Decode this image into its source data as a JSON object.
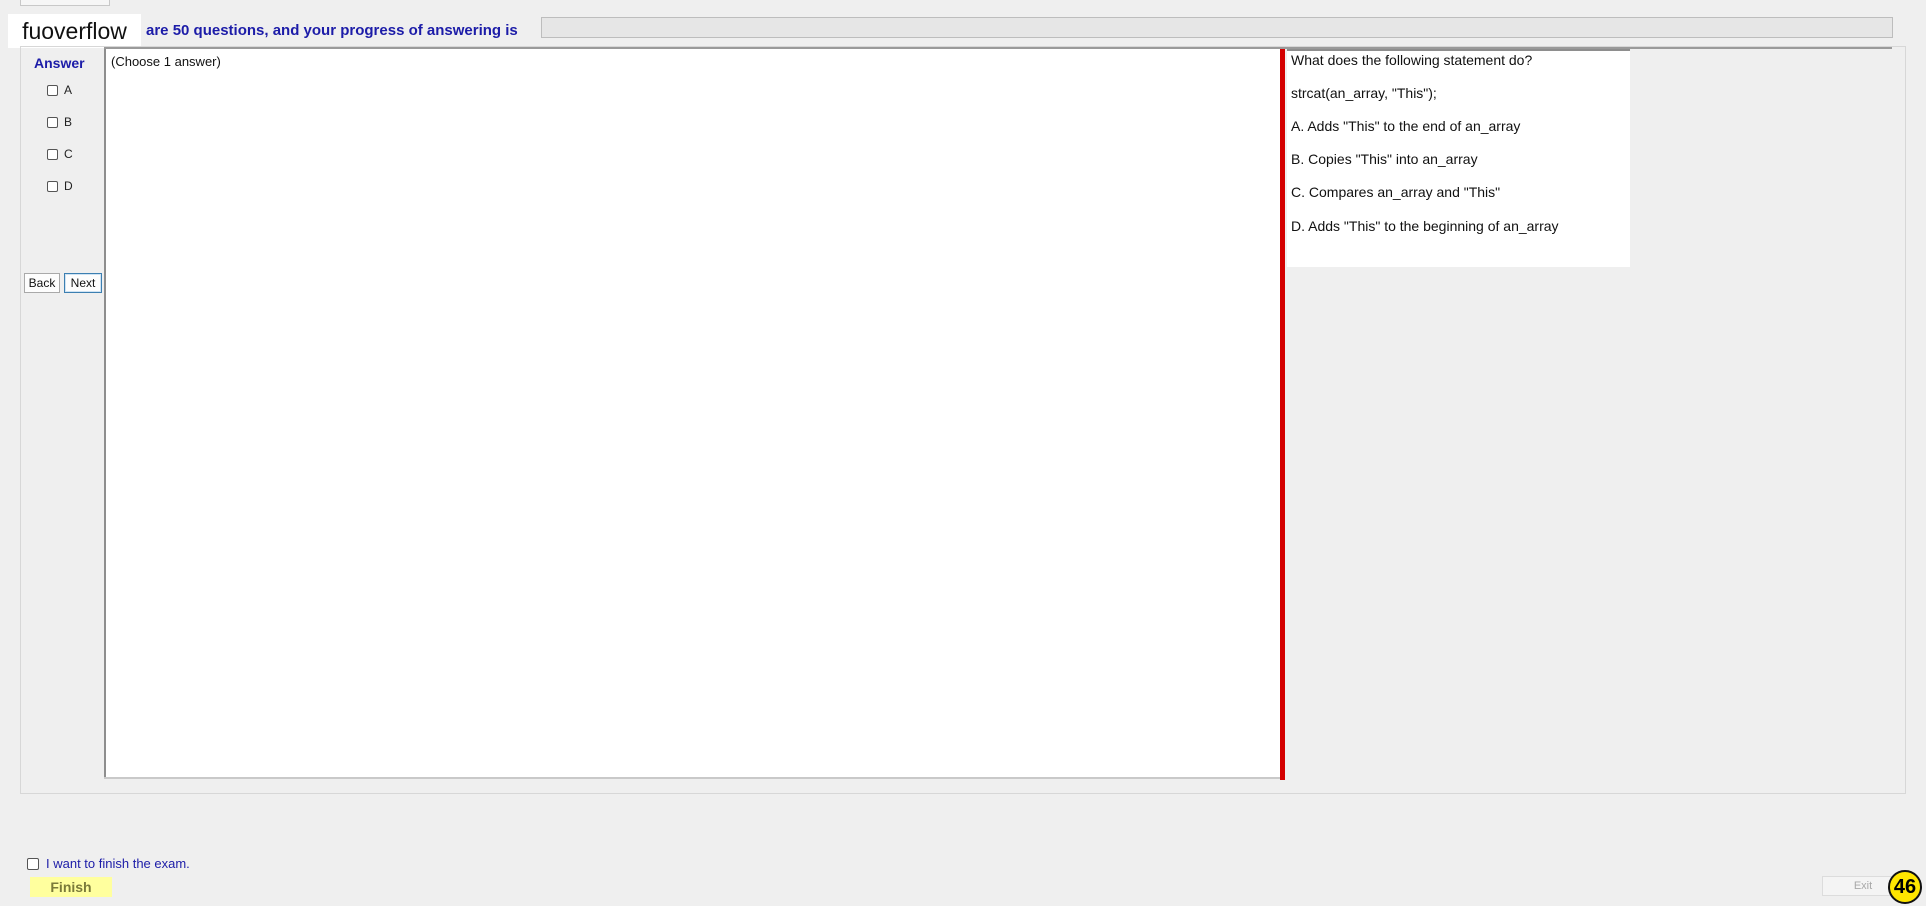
{
  "header": {
    "logo_text": "fuoverflow",
    "progress_text": "are 50 questions, and your progress of answering is",
    "progress_fraction": 0
  },
  "answer_panel": {
    "title": "Answer",
    "options": [
      {
        "label": "A",
        "checked": false
      },
      {
        "label": "B",
        "checked": false
      },
      {
        "label": "C",
        "checked": false
      },
      {
        "label": "D",
        "checked": false
      }
    ],
    "back_label": "Back",
    "next_label": "Next"
  },
  "answer_area": {
    "instruction": "(Choose 1 answer)"
  },
  "question": {
    "prompt": "What does the following statement do?",
    "code": " strcat(an_array, \"This\");",
    "choices": [
      "A.  Adds \"This\" to the end of an_array",
      "B.  Copies \"This\" into an_array",
      "C.  Compares an_array and \"This\"",
      "D.  Adds \"This\" to the beginning of an_array"
    ]
  },
  "footer": {
    "finish_checkbox_label": "I want to finish the exam.",
    "finish_label": "Finish",
    "exit_label": "Exit",
    "question_number": "46"
  },
  "colors": {
    "accent_blue": "#1c1ca8",
    "divider_red": "#d40000",
    "finish_yellow": "#ffff9e",
    "counter_yellow": "#ffe600"
  }
}
